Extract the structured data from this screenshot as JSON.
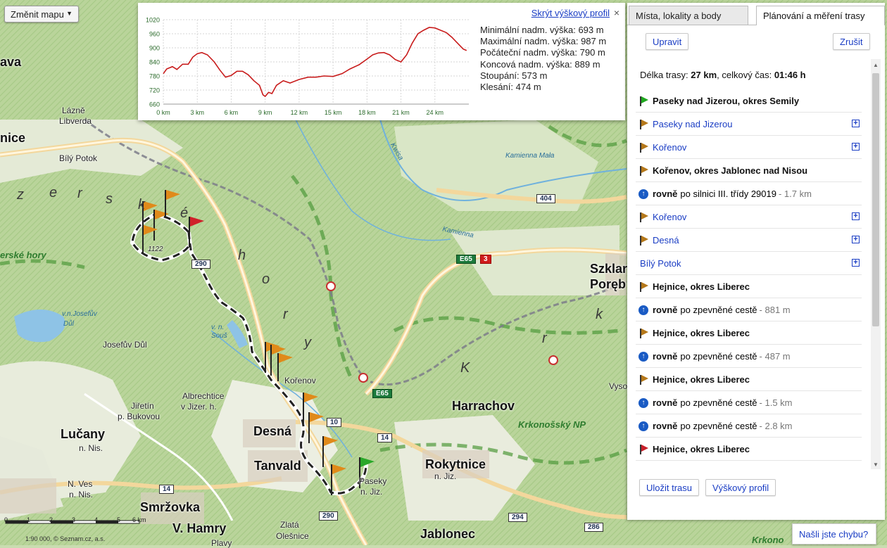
{
  "map": {
    "change_map_label": "Změnit mapu",
    "labels": {
      "town_big": [
        {
          "id": "hejnice",
          "text": "nice"
        },
        {
          "id": "harrachov",
          "text": "Harrachov"
        },
        {
          "id": "desna",
          "text": "Desná"
        },
        {
          "id": "tanvald",
          "text": "Tanvald"
        },
        {
          "id": "rokytnice",
          "text": "Rokytnice"
        },
        {
          "id": "lucany",
          "text": "Lučany"
        },
        {
          "id": "smrzovka",
          "text": "Smržovka"
        },
        {
          "id": "vhamry",
          "text": "V. Hamry"
        },
        {
          "id": "jablonec",
          "text": "Jablonec"
        },
        {
          "id": "szklarska",
          "text": "Szklar"
        },
        {
          "id": "poreba",
          "text": "Poręb"
        },
        {
          "id": "ava",
          "text": "ava"
        }
      ],
      "town_small": [
        {
          "id": "lazne",
          "text": "Lázně"
        },
        {
          "id": "libverda",
          "text": "Libverda"
        },
        {
          "id": "bily_potok",
          "text": "Bílý Potok"
        },
        {
          "id": "josefuv_dul",
          "text": "Josefův Důl"
        },
        {
          "id": "albrechtice",
          "text": "Albrechtice"
        },
        {
          "id": "albrechtice2",
          "text": "v Jizer. h."
        },
        {
          "id": "jiretin",
          "text": "Jiřetín"
        },
        {
          "id": "jiretin2",
          "text": "p. Bukovou"
        },
        {
          "id": "korenov",
          "text": "Kořenov"
        },
        {
          "id": "lucany2",
          "text": "n. Nis."
        },
        {
          "id": "nves",
          "text": "N. Ves"
        },
        {
          "id": "nves2",
          "text": "n. Nis."
        },
        {
          "id": "rokytnice2",
          "text": "n. Jiz."
        },
        {
          "id": "paseky",
          "text": "Paseky"
        },
        {
          "id": "paseky2",
          "text": "n. Jiz."
        },
        {
          "id": "zlata",
          "text": "Zlatá"
        },
        {
          "id": "olesnice",
          "text": "Olešnice"
        },
        {
          "id": "vysoke",
          "text": "Vysok"
        },
        {
          "id": "plavy",
          "text": "Plavy"
        },
        {
          "id": "summit",
          "text": "1122"
        }
      ],
      "water": [
        {
          "id": "kwisa",
          "text": "Kwisa"
        },
        {
          "id": "kamienna_mala",
          "text": "Kamienna Mała"
        },
        {
          "id": "kamienna",
          "text": "Kamienna"
        },
        {
          "id": "vn_josefuv",
          "text": "v.n.Josefův"
        },
        {
          "id": "vn_josefuv2",
          "text": "Důl"
        },
        {
          "id": "vn_sous",
          "text": "v. n."
        },
        {
          "id": "vn_sous2",
          "text": "Souš"
        }
      ],
      "park": [
        {
          "id": "krkonossky",
          "text": "Krkonošský NP"
        },
        {
          "id": "jizerske",
          "text": "erské hory"
        },
        {
          "id": "krkonosze",
          "text": "Krkono"
        }
      ],
      "mountain_letters": [
        "z",
        "e",
        "r",
        "s",
        "k",
        "é",
        "h",
        "o",
        "r",
        "y",
        "K",
        "r",
        "k"
      ]
    },
    "roads": [
      {
        "id": "r404",
        "text": "404",
        "style": "white"
      },
      {
        "id": "e65a",
        "text": "E65",
        "style": "green"
      },
      {
        "id": "r3",
        "text": "3",
        "style": "red"
      },
      {
        "id": "e65b",
        "text": "E65",
        "style": "green"
      },
      {
        "id": "r290a",
        "text": "290",
        "style": "white"
      },
      {
        "id": "r10",
        "text": "10",
        "style": "white"
      },
      {
        "id": "r14a",
        "text": "14",
        "style": "white"
      },
      {
        "id": "r14b",
        "text": "14",
        "style": "white"
      },
      {
        "id": "r290b",
        "text": "290",
        "style": "white"
      },
      {
        "id": "r294",
        "text": "294",
        "style": "white"
      },
      {
        "id": "r286",
        "text": "286",
        "style": "white"
      }
    ],
    "scale_labels": [
      "0",
      "1",
      "2",
      "3",
      "4",
      "5",
      "6 km"
    ],
    "copyright": "1:90 000, © Seznam.cz, a.s."
  },
  "elevation": {
    "hide_label": "Skrýt výškový profil",
    "close_label": "×",
    "stats": [
      {
        "label": "Minimální nadm. výška:",
        "value": "693 m"
      },
      {
        "label": "Maximální nadm. výška:",
        "value": "987 m"
      },
      {
        "label": "Počáteční nadm. výška:",
        "value": "790 m"
      },
      {
        "label": "Koncová nadm. výška:",
        "value": "889 m"
      },
      {
        "label": "Stoupání:",
        "value": "573 m"
      },
      {
        "label": "Klesání:",
        "value": "474 m"
      }
    ]
  },
  "chart_data": {
    "type": "line",
    "title": "",
    "xlabel": "",
    "ylabel": "",
    "x_unit": "km",
    "xlim": [
      0,
      27
    ],
    "ylim": [
      660,
      1020
    ],
    "x_ticks": [
      "0 km",
      "3 km",
      "6 km",
      "9 km",
      "12 km",
      "15 km",
      "18 km",
      "21 km",
      "24 km"
    ],
    "y_ticks": [
      "1020",
      "960",
      "900",
      "840",
      "780",
      "720",
      "660"
    ],
    "x_tick_values": [
      0,
      3,
      6,
      9,
      12,
      15,
      18,
      21,
      24
    ],
    "y_tick_values": [
      1020,
      960,
      900,
      840,
      780,
      720,
      660
    ],
    "grid": true,
    "color": "#c81c1c",
    "series": [
      {
        "x": [
          0,
          0.3,
          0.8,
          1.2,
          1.7,
          2.2,
          2.6,
          3.0,
          3.4,
          3.9,
          4.5,
          5.0,
          5.5,
          6.0,
          6.5,
          7.0,
          7.5,
          8.0,
          8.5,
          8.8,
          9.0,
          9.3,
          9.6,
          10.0,
          10.6,
          11.2,
          12.0,
          12.8,
          13.5,
          14.2,
          15.0,
          15.8,
          16.5,
          17.3,
          18.0,
          18.5,
          19.0,
          19.5,
          20.0,
          20.5,
          21.0,
          21.5,
          22.0,
          22.5,
          23.0,
          23.5,
          24.0,
          24.5,
          25.0,
          25.5,
          26.0,
          26.5,
          26.8
        ],
        "y": [
          790,
          810,
          820,
          808,
          830,
          830,
          860,
          875,
          880,
          870,
          840,
          805,
          775,
          782,
          800,
          800,
          785,
          760,
          740,
          700,
          693,
          710,
          705,
          740,
          760,
          750,
          765,
          775,
          775,
          780,
          778,
          790,
          810,
          828,
          852,
          870,
          878,
          880,
          870,
          850,
          840,
          870,
          920,
          960,
          975,
          987,
          985,
          975,
          965,
          945,
          920,
          895,
          889
        ]
      }
    ]
  },
  "panel": {
    "tabs": [
      {
        "id": "places",
        "label": "Místa, lokality a body",
        "active": false
      },
      {
        "id": "planning",
        "label": "Plánování a měření trasy",
        "active": true
      }
    ],
    "edit_label": "Upravit",
    "cancel_label": "Zrušit",
    "summary": {
      "length_label": "Délka trasy:",
      "length_value": "27 km",
      "time_label": "celkový čas:",
      "time_value": "01:46 h"
    },
    "rows": [
      {
        "kind": "place",
        "flag": "start",
        "text": "Paseky nad Jizerou, okres Semily"
      },
      {
        "kind": "waypoint",
        "flag": "mid",
        "text": "Paseky nad Jizerou",
        "plus": "+"
      },
      {
        "kind": "waypoint",
        "flag": "mid",
        "text": "Kořenov",
        "plus": "+"
      },
      {
        "kind": "place",
        "flag": "mid",
        "text": "Kořenov, okres Jablonec nad Nisou"
      },
      {
        "kind": "direction",
        "icon": "↑",
        "bold": "rovně",
        "text": "po silnici III. třídy 29019",
        "dist": "- 1.7 km"
      },
      {
        "kind": "waypoint",
        "flag": "mid",
        "text": "Kořenov",
        "plus": "+"
      },
      {
        "kind": "waypoint",
        "flag": "mid",
        "text": "Desná",
        "plus": "+"
      },
      {
        "kind": "waypoint",
        "flag": "none",
        "text": "Bílý Potok",
        "plus": "+"
      },
      {
        "kind": "place",
        "flag": "mid",
        "text": "Hejnice, okres Liberec"
      },
      {
        "kind": "direction",
        "icon": "↑",
        "bold": "rovně",
        "text": "po zpevněné cestě",
        "dist": "- 881 m"
      },
      {
        "kind": "place",
        "flag": "mid",
        "text": "Hejnice, okres Liberec"
      },
      {
        "kind": "direction",
        "icon": "↑",
        "bold": "rovně",
        "text": "po zpevněné cestě",
        "dist": "- 487 m"
      },
      {
        "kind": "place",
        "flag": "mid",
        "text": "Hejnice, okres Liberec"
      },
      {
        "kind": "direction",
        "icon": "↑",
        "bold": "rovně",
        "text": "po zpevněné cestě",
        "dist": "- 1.5 km"
      },
      {
        "kind": "direction",
        "icon": "↑",
        "bold": "rovně",
        "text": "po zpevněné cestě",
        "dist": "- 2.8 km"
      },
      {
        "kind": "place",
        "flag": "end",
        "text": "Hejnice, okres Liberec"
      }
    ],
    "save_label": "Uložit trasu",
    "profile_label": "Výškový profil"
  },
  "bug_label": "Našli jste chybu?"
}
